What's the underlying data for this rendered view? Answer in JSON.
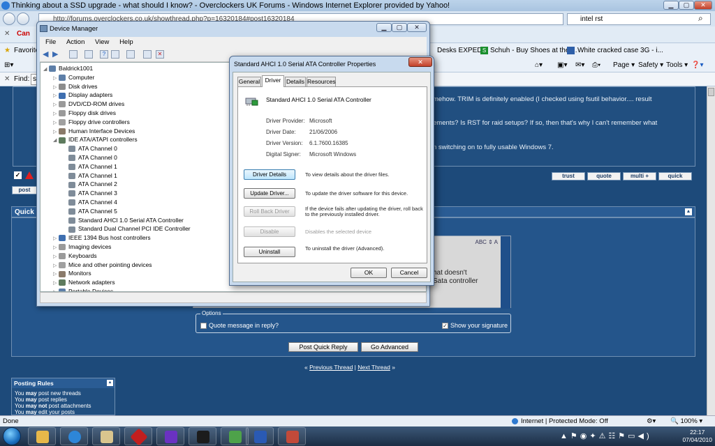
{
  "ie": {
    "title": "Thinking about a SSD upgrade - what should I know? - Overclockers UK Forums - Windows Internet Explorer provided by Yahoo!",
    "url": "http://forums.overclockers.co.uk/showthread.php?p=16320184#post16320184",
    "search_value": "intel rst",
    "favorites_label": "Favorite",
    "fav_links": [
      "Desks  EXPED...",
      "Schuh - Buy Shoes at the ...",
      "White cracked case 3G - i..."
    ],
    "cmd": {
      "page": "Page",
      "safety": "Safety",
      "tools": "Tools"
    },
    "find_label": "Find:",
    "find_value": "s",
    "status_left": "Done",
    "zone": "Internet | Protected Mode: Off",
    "zoom": "100%",
    "tab_fragment": "Can"
  },
  "forum": {
    "post_lines": [
      "mehow. TRIM is definitely enabled (I checked using fsutil behavior.... result",
      "ements? Is RST for raid setups? If so, then that's why I can't remember what",
      "n switching on to fully usable Windows 7."
    ],
    "post_buttons": [
      "trust",
      "quote",
      "multi +",
      "quick"
    ],
    "post_label": "post",
    "quick_header": "Quick",
    "editor_lines": [
      "hat doesn't",
      "Sata controller"
    ],
    "options_legend": "Options",
    "quote_label": "Quote message in reply?",
    "signature_label": "Show your signature",
    "post_quick_reply": "Post Quick Reply",
    "go_advanced": "Go Advanced",
    "prev_thread": "Previous Thread",
    "next_thread": "Next Thread",
    "rules_title": "Posting Rules",
    "rules": [
      [
        "You ",
        "may",
        " post new threads"
      ],
      [
        "You ",
        "may",
        " post replies"
      ],
      [
        "You ",
        "may not",
        " post attachments"
      ],
      [
        "You ",
        "may",
        " edit your posts"
      ]
    ]
  },
  "device_manager": {
    "title": "Device Manager",
    "menu": [
      "File",
      "Action",
      "View",
      "Help"
    ],
    "root": "Baldrick1001",
    "tree": [
      {
        "label": "Computer",
        "level": 1
      },
      {
        "label": "Disk drives",
        "level": 1
      },
      {
        "label": "Display adapters",
        "level": 1
      },
      {
        "label": "DVD/CD-ROM drives",
        "level": 1
      },
      {
        "label": "Floppy disk drives",
        "level": 1
      },
      {
        "label": "Floppy drive controllers",
        "level": 1
      },
      {
        "label": "Human Interface Devices",
        "level": 1
      },
      {
        "label": "IDE ATA/ATAPI controllers",
        "level": 1,
        "expanded": true
      },
      {
        "label": "ATA Channel 0",
        "level": 2
      },
      {
        "label": "ATA Channel 0",
        "level": 2
      },
      {
        "label": "ATA Channel 1",
        "level": 2
      },
      {
        "label": "ATA Channel 1",
        "level": 2
      },
      {
        "label": "ATA Channel 2",
        "level": 2
      },
      {
        "label": "ATA Channel 3",
        "level": 2
      },
      {
        "label": "ATA Channel 4",
        "level": 2
      },
      {
        "label": "ATA Channel 5",
        "level": 2
      },
      {
        "label": "Standard AHCI 1.0 Serial ATA Controller",
        "level": 2
      },
      {
        "label": "Standard Dual Channel PCI IDE Controller",
        "level": 2
      },
      {
        "label": "IEEE 1394 Bus host controllers",
        "level": 1
      },
      {
        "label": "Imaging devices",
        "level": 1
      },
      {
        "label": "Keyboards",
        "level": 1
      },
      {
        "label": "Mice and other pointing devices",
        "level": 1
      },
      {
        "label": "Monitors",
        "level": 1
      },
      {
        "label": "Network adapters",
        "level": 1
      },
      {
        "label": "Portable Devices",
        "level": 1
      }
    ]
  },
  "properties": {
    "title": "Standard AHCI 1.0 Serial ATA Controller Properties",
    "tabs": [
      "General",
      "Driver",
      "Details",
      "Resources"
    ],
    "active_tab": "Driver",
    "device_name": "Standard AHCI 1.0 Serial ATA Controller",
    "fields": [
      {
        "label": "Driver Provider:",
        "value": "Microsoft"
      },
      {
        "label": "Driver Date:",
        "value": "21/06/2006"
      },
      {
        "label": "Driver Version:",
        "value": "6.1.7600.16385"
      },
      {
        "label": "Digital Signer:",
        "value": "Microsoft Windows"
      }
    ],
    "buttons": [
      {
        "label": "Driver Details",
        "desc": "To view details about the driver files.",
        "enabled": true
      },
      {
        "label": "Update Driver...",
        "desc": "To update the driver software for this device.",
        "enabled": true
      },
      {
        "label": "Roll Back Driver",
        "desc": "If the device fails after updating the driver, roll back to the previously installed driver.",
        "enabled": false
      },
      {
        "label": "Disable",
        "desc": "Disables the selected device",
        "enabled": false
      },
      {
        "label": "Uninstall",
        "desc": "To uninstall the driver (Advanced).",
        "enabled": true
      }
    ],
    "ok": "OK",
    "cancel": "Cancel"
  },
  "taskbar": {
    "time": "22:17",
    "date": "07/04/2010"
  }
}
